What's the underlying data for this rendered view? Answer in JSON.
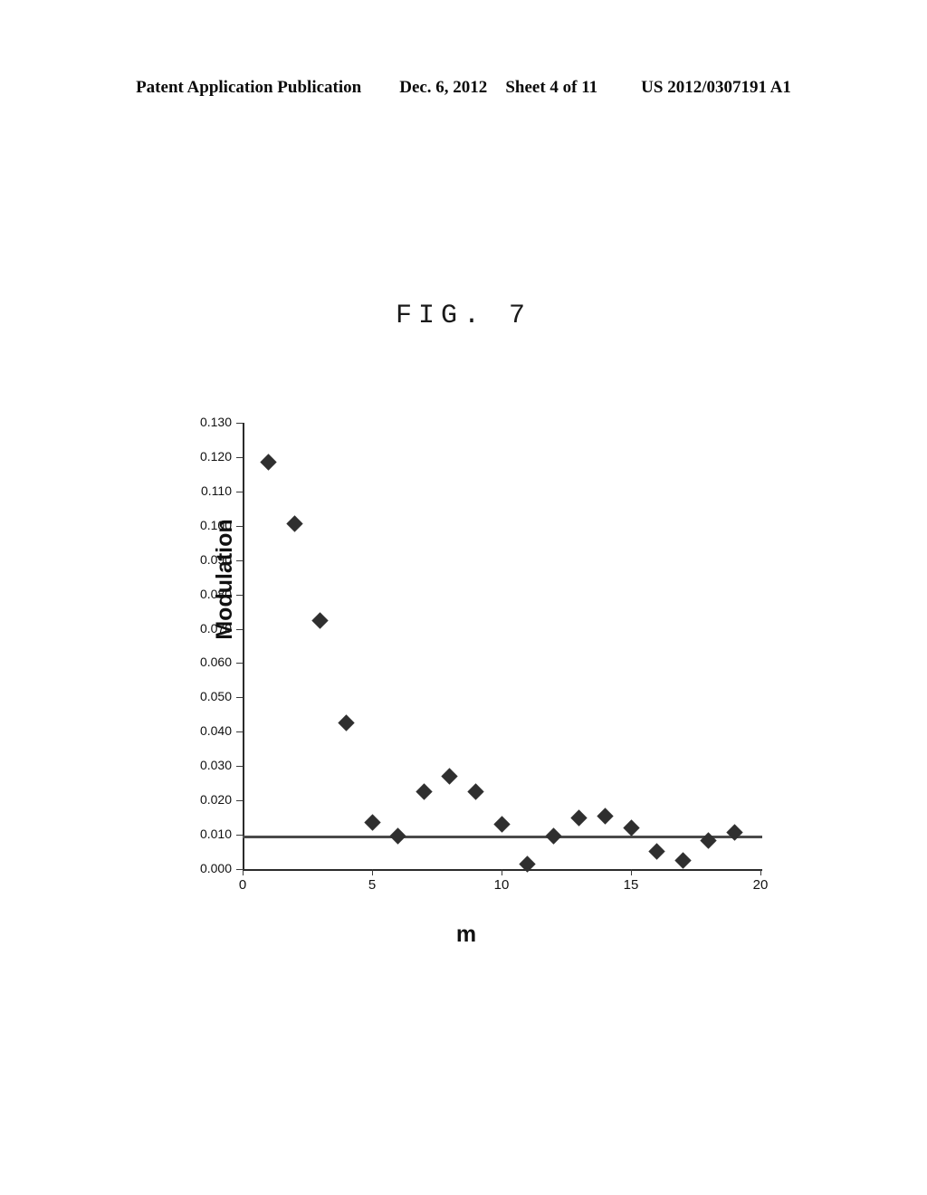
{
  "header": {
    "publication": "Patent Application Publication",
    "date": "Dec. 6, 2012",
    "sheet": "Sheet 4 of 11",
    "docnum": "US 2012/0307191 A1"
  },
  "figure": {
    "caption": "FIG. 7"
  },
  "chart_data": {
    "type": "scatter",
    "title": "FIG. 7",
    "xlabel": "m",
    "ylabel": "Modulation",
    "xlim": [
      0,
      20
    ],
    "ylim": [
      0.0,
      0.13
    ],
    "xticks": [
      "0",
      "5",
      "10",
      "15",
      "20"
    ],
    "xtick_values": [
      0,
      5,
      10,
      15,
      20
    ],
    "yticks": [
      "0.000",
      "0.010",
      "0.020",
      "0.030",
      "0.040",
      "0.050",
      "0.060",
      "0.070",
      "0.080",
      "0.090",
      "0.100",
      "0.110",
      "0.120",
      "0.130"
    ],
    "ytick_values": [
      0.0,
      0.01,
      0.02,
      0.03,
      0.04,
      0.05,
      0.06,
      0.07,
      0.08,
      0.09,
      0.1,
      0.11,
      0.12,
      0.13
    ],
    "grid": false,
    "legend": null,
    "marker": "diamond",
    "marker_color": "#2f2f2f",
    "x": [
      1,
      2,
      3,
      4,
      5,
      6,
      7,
      8,
      9,
      10,
      11,
      12,
      13,
      14,
      15,
      16,
      17,
      18,
      19
    ],
    "values": [
      0.1185,
      0.1005,
      0.0725,
      0.0425,
      0.0135,
      0.0095,
      0.0225,
      0.027,
      0.0225,
      0.013,
      0.0015,
      0.0095,
      0.0148,
      0.0155,
      0.012,
      0.0052,
      0.0025,
      0.0082,
      0.0108
    ],
    "reference_line": {
      "value": 0.0095,
      "orientation": "horizontal",
      "color": "#4a4a4a"
    }
  }
}
